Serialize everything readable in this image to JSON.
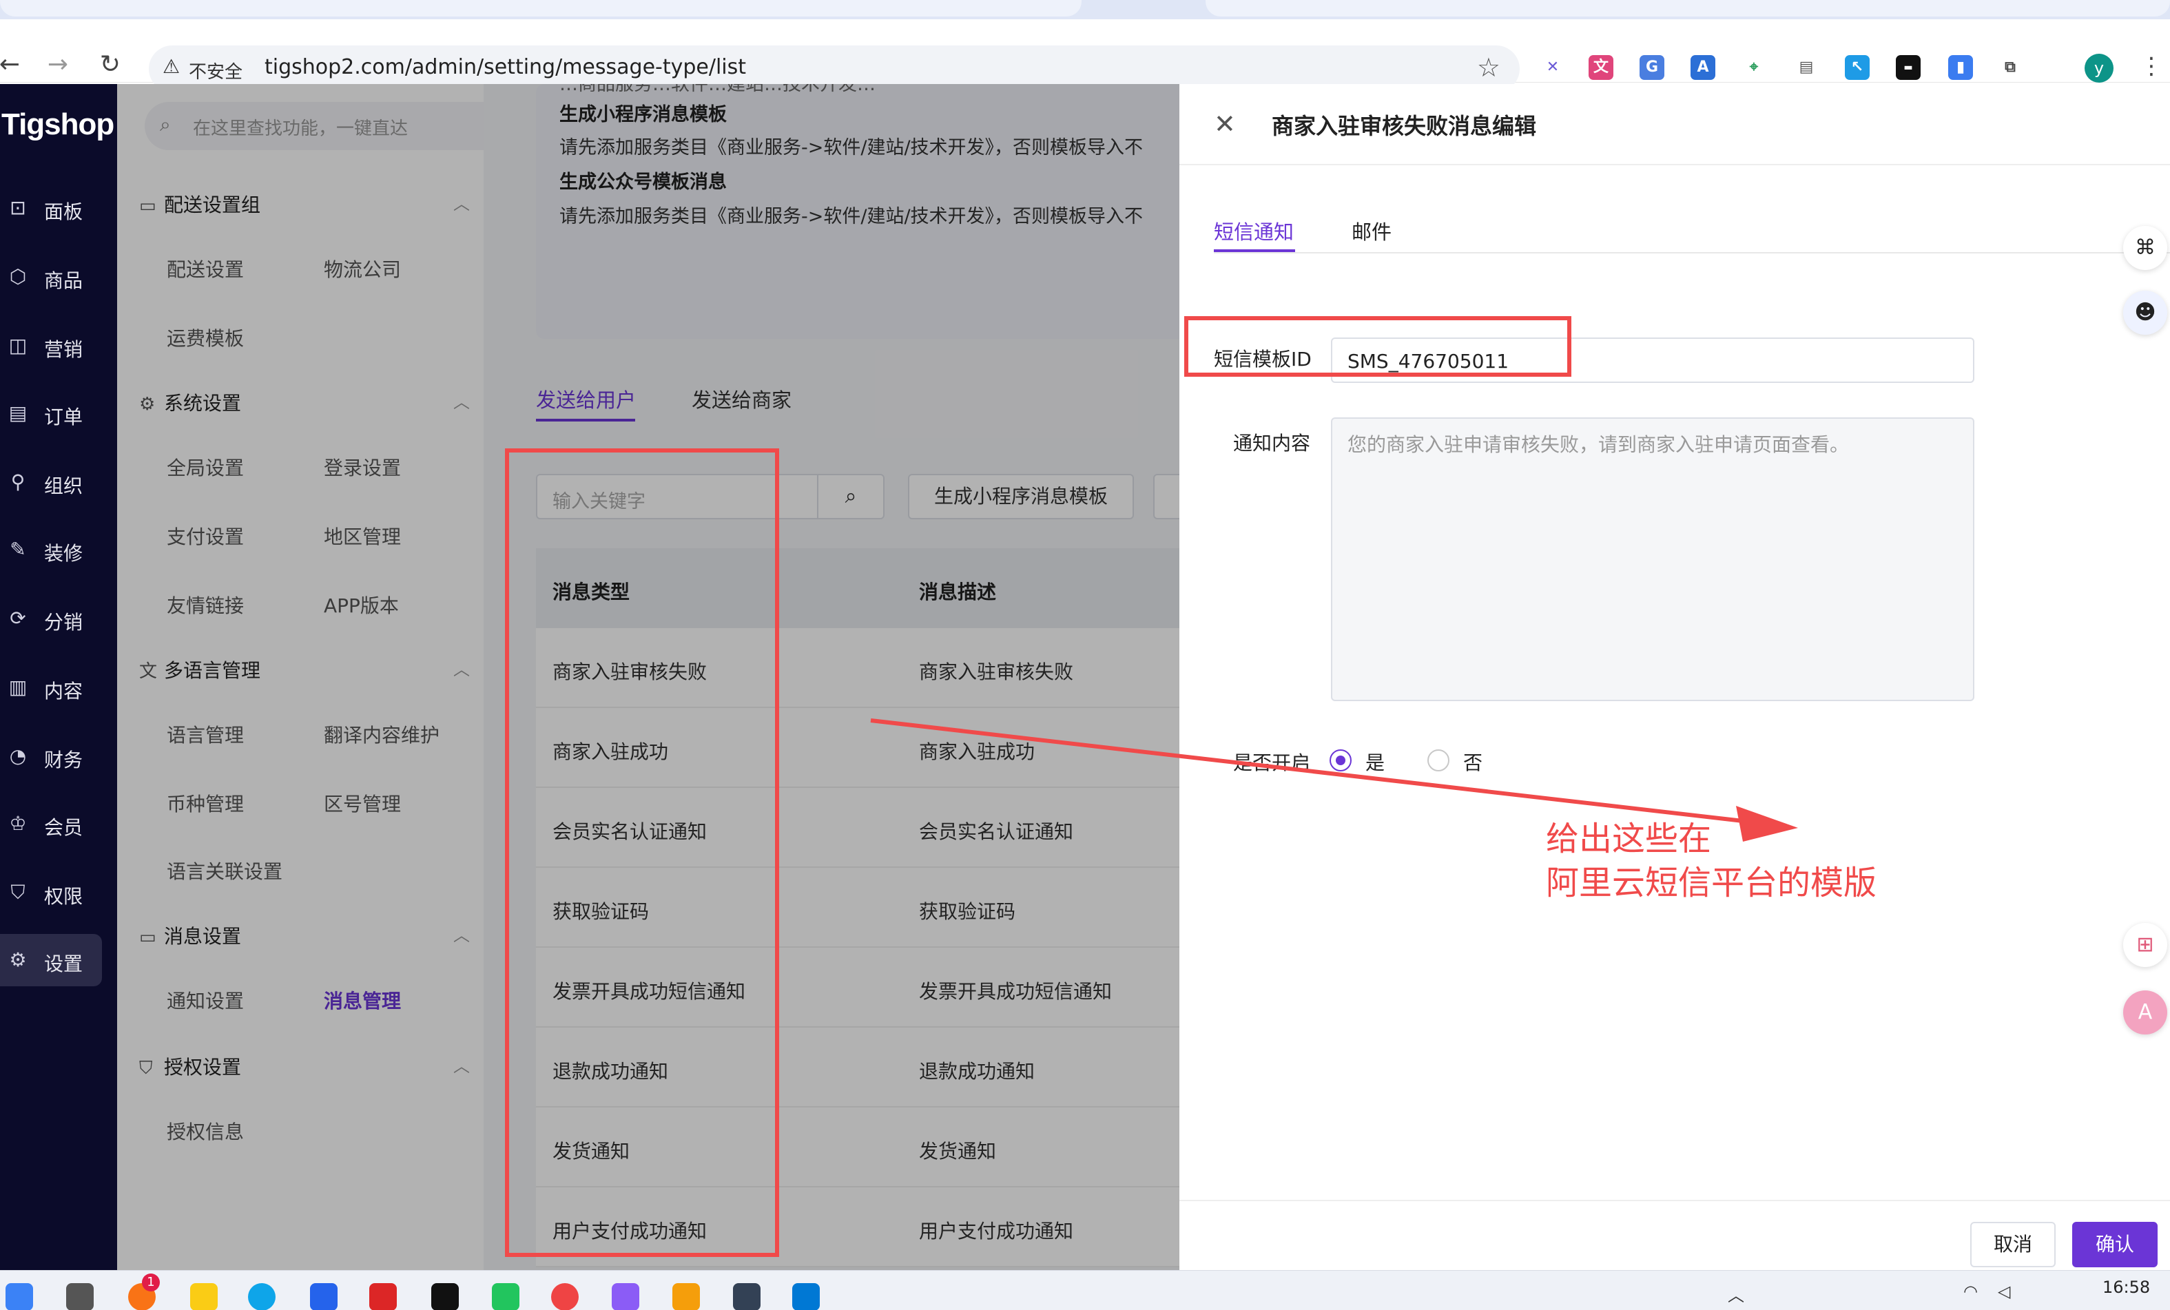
{
  "browser": {
    "insecure_label": "不安全",
    "url": "tigshop2.com/admin/setting/message-type/list",
    "profile_initial": "y"
  },
  "app": {
    "logo": "Tigshop",
    "search_placeholder": "在这里查找功能，一键直达",
    "main_nav": [
      {
        "label": "面板",
        "icon": "chart-icon"
      },
      {
        "label": "商品",
        "icon": "box-icon"
      },
      {
        "label": "营销",
        "icon": "megaphone-icon"
      },
      {
        "label": "订单",
        "icon": "order-icon"
      },
      {
        "label": "组织",
        "icon": "org-icon"
      },
      {
        "label": "装修",
        "icon": "brush-icon"
      },
      {
        "label": "分销",
        "icon": "share-icon"
      },
      {
        "label": "内容",
        "icon": "content-icon"
      },
      {
        "label": "财务",
        "icon": "pie-icon"
      },
      {
        "label": "会员",
        "icon": "member-icon"
      },
      {
        "label": "权限",
        "icon": "shield-icon"
      },
      {
        "label": "设置",
        "icon": "settings-icon"
      }
    ],
    "sub_nav": {
      "groups": [
        {
          "title": "配送设置组",
          "items": [
            "配送设置",
            "物流公司",
            "运费模板"
          ]
        },
        {
          "title": "系统设置",
          "items": [
            "全局设置",
            "登录设置",
            "支付设置",
            "地区管理",
            "友情链接",
            "APP版本"
          ]
        },
        {
          "title": "多语言管理",
          "items": [
            "语言管理",
            "翻译内容维护",
            "币种管理",
            "区号管理",
            "语言关联设置"
          ]
        },
        {
          "title": "消息设置",
          "items": [
            "通知设置",
            "消息管理"
          ]
        },
        {
          "title": "授权设置",
          "items": [
            "授权信息"
          ]
        }
      ]
    }
  },
  "notice": {
    "line0": "…商品服务…软件…建站…技术开发…",
    "title_mini": "生成小程序消息模板",
    "text_mini": "请先添加服务类目《商业服务->软件/建站/技术开发》，否则模板导入不",
    "title_mp": "生成公众号模板消息",
    "text_mp": "请先添加服务类目《商业服务->软件/建站/技术开发》，否则模板导入不"
  },
  "content_tabs": {
    "user": "发送给用户",
    "merchant": "发送给商家"
  },
  "filter": {
    "keyword_placeholder": "输入关键字",
    "gen_mini_button": "生成小程序消息模板"
  },
  "table": {
    "headers": [
      "消息类型",
      "消息描述"
    ],
    "rows": [
      [
        "商家入驻审核失败",
        "商家入驻审核失败"
      ],
      [
        "商家入驻成功",
        "商家入驻成功"
      ],
      [
        "会员实名认证通知",
        "会员实名认证通知"
      ],
      [
        "获取验证码",
        "获取验证码"
      ],
      [
        "发票开具成功短信通知",
        "发票开具成功短信通知"
      ],
      [
        "退款成功通知",
        "退款成功通知"
      ],
      [
        "发货通知",
        "发货通知"
      ],
      [
        "用户支付成功通知",
        "用户支付成功通知"
      ]
    ]
  },
  "drawer": {
    "title": "商家入驻审核失败消息编辑",
    "tabs": [
      "短信通知",
      "邮件"
    ],
    "template_id_label": "短信模板ID",
    "template_id_value": "SMS_476705011",
    "content_label": "通知内容",
    "content_placeholder": "您的商家入驻申请审核失败，请到商家入驻申请页面查看。",
    "enabled_label": "是否开启",
    "yes_label": "是",
    "no_label": "否",
    "enabled": true,
    "cancel_label": "取消",
    "confirm_label": "确认"
  },
  "annotation": {
    "line1": "给出这些在",
    "line2": "阿里云短信平台的模版"
  },
  "taskbar": {
    "time": "16:58",
    "badge_count": "1"
  },
  "colors": {
    "accent": "#6b35d6",
    "sidebar_bg": "#0b0b2a",
    "annotation_red": "#f04a4a"
  }
}
